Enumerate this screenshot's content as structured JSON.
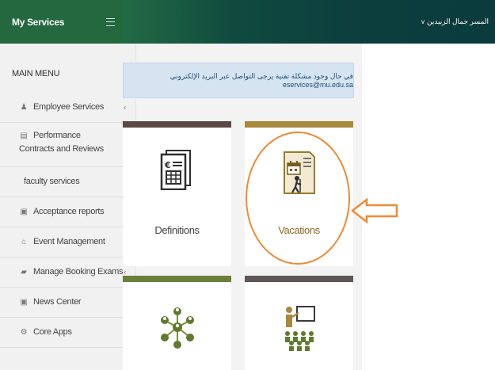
{
  "topbar": {
    "brand_title": "My Services",
    "user_name": "المسر جمال الزبيدين",
    "user_chevron": "v"
  },
  "sidebar": {
    "main_menu_title": "MAIN MENU",
    "items": [
      {
        "label": "Employee Services",
        "icon": "person-icon",
        "glyph": "♟"
      },
      {
        "label": "Performance Contracts and Reviews",
        "icon": "document-icon",
        "glyph": "▤"
      },
      {
        "label": "faculty services",
        "icon": "",
        "glyph": ""
      },
      {
        "label": "Acceptance reports",
        "icon": "report-icon",
        "glyph": "▣"
      },
      {
        "label": "Event Management",
        "icon": "institution-icon",
        "glyph": "⌂"
      },
      {
        "label": "Manage Booking Exams",
        "icon": "book-icon",
        "glyph": "▰"
      },
      {
        "label": "News Center",
        "icon": "newspaper-icon",
        "glyph": "▣"
      },
      {
        "label": "Core Apps",
        "icon": "gear-icon",
        "glyph": "⚙"
      }
    ],
    "chevron": "‹"
  },
  "alert": {
    "text": "في حال وجود مشكلة تقنية يرجى التواصل عبر البريد الإلكتروني eservices@mu.edu.sa"
  },
  "cards": [
    {
      "label": "Definitions",
      "bar_color": "#5a4a43",
      "icon": "documents-icon"
    },
    {
      "label": "Vacations",
      "bar_color": "#a8883c",
      "icon": "vacation-calendar-icon"
    },
    {
      "label": "",
      "bar_color": "#6a7f3b",
      "icon": "network-people-icon"
    },
    {
      "label": "",
      "bar_color": "#5c5656",
      "icon": "presentation-icon"
    }
  ],
  "colors": {
    "brand_green": "#23683f",
    "highlight": "#f08a32",
    "vacation_label": "#8a6a22"
  }
}
